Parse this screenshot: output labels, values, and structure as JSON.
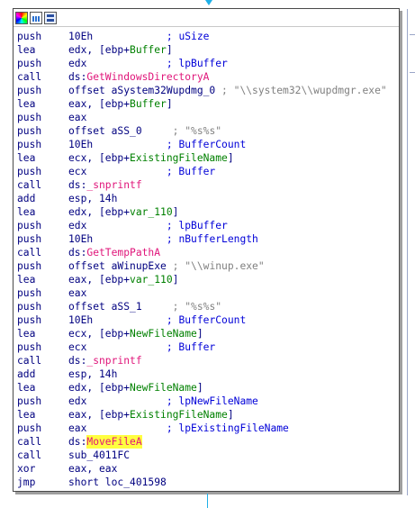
{
  "colors": {
    "instruction": "#000080",
    "comment": "#0000d8",
    "string_comment": "#808080",
    "api_reference": "#e0157a",
    "local_variable": "#008000",
    "highlight": "#ffff40",
    "edge": "#1fb0e8"
  },
  "titlebar_icons": [
    "color-palette-icon",
    "bar-chart-icon",
    "graph-overview-icon"
  ],
  "lines": [
    {
      "mn": "push",
      "p": [
        {
          "t": "10Eh",
          "c": "op"
        }
      ],
      "g": "            ",
      "cm": [
        {
          "t": "; uSize",
          "c": "cm"
        }
      ]
    },
    {
      "mn": "lea",
      "p": [
        {
          "t": "edx, [ebp+",
          "c": "op"
        },
        {
          "t": "Buffer",
          "c": "loc"
        },
        {
          "t": "]",
          "c": "op"
        }
      ],
      "g": "",
      "cm": []
    },
    {
      "mn": "push",
      "p": [
        {
          "t": "edx",
          "c": "op"
        }
      ],
      "g": "             ",
      "cm": [
        {
          "t": "; lpBuffer",
          "c": "cm"
        }
      ]
    },
    {
      "mn": "call",
      "p": [
        {
          "t": "ds:",
          "c": "op"
        },
        {
          "t": "GetWindowsDirectoryA",
          "c": "ref"
        }
      ],
      "g": "",
      "cm": []
    },
    {
      "mn": "push",
      "p": [
        {
          "t": "offset aSystem32Wupdmg_0",
          "c": "op"
        }
      ],
      "g": " ",
      "cm": [
        {
          "t": "; \"\\\\system32\\\\wupdmgr.exe\"",
          "c": "str"
        }
      ]
    },
    {
      "mn": "lea",
      "p": [
        {
          "t": "eax, [ebp+",
          "c": "op"
        },
        {
          "t": "Buffer",
          "c": "loc"
        },
        {
          "t": "]",
          "c": "op"
        }
      ],
      "g": "",
      "cm": []
    },
    {
      "mn": "push",
      "p": [
        {
          "t": "eax",
          "c": "op"
        }
      ],
      "g": "",
      "cm": []
    },
    {
      "mn": "push",
      "p": [
        {
          "t": "offset aSS_0",
          "c": "op"
        }
      ],
      "g": "     ",
      "cm": [
        {
          "t": "; \"%s%s\"",
          "c": "str"
        }
      ]
    },
    {
      "mn": "push",
      "p": [
        {
          "t": "10Eh",
          "c": "op"
        }
      ],
      "g": "            ",
      "cm": [
        {
          "t": "; BufferCount",
          "c": "cm"
        }
      ]
    },
    {
      "mn": "lea",
      "p": [
        {
          "t": "ecx, [ebp+",
          "c": "op"
        },
        {
          "t": "ExistingFileName",
          "c": "loc"
        },
        {
          "t": "]",
          "c": "op"
        }
      ],
      "g": "",
      "cm": []
    },
    {
      "mn": "push",
      "p": [
        {
          "t": "ecx",
          "c": "op"
        }
      ],
      "g": "             ",
      "cm": [
        {
          "t": "; Buffer",
          "c": "cm"
        }
      ]
    },
    {
      "mn": "call",
      "p": [
        {
          "t": "ds:",
          "c": "op"
        },
        {
          "t": "_snprintf",
          "c": "ref"
        }
      ],
      "g": "",
      "cm": []
    },
    {
      "mn": "add",
      "p": [
        {
          "t": "esp, 14h",
          "c": "op"
        }
      ],
      "g": "",
      "cm": []
    },
    {
      "mn": "lea",
      "p": [
        {
          "t": "edx, [ebp+",
          "c": "op"
        },
        {
          "t": "var_110",
          "c": "loc"
        },
        {
          "t": "]",
          "c": "op"
        }
      ],
      "g": "",
      "cm": []
    },
    {
      "mn": "push",
      "p": [
        {
          "t": "edx",
          "c": "op"
        }
      ],
      "g": "             ",
      "cm": [
        {
          "t": "; lpBuffer",
          "c": "cm"
        }
      ]
    },
    {
      "mn": "push",
      "p": [
        {
          "t": "10Eh",
          "c": "op"
        }
      ],
      "g": "            ",
      "cm": [
        {
          "t": "; nBufferLength",
          "c": "cm"
        }
      ]
    },
    {
      "mn": "call",
      "p": [
        {
          "t": "ds:",
          "c": "op"
        },
        {
          "t": "GetTempPathA",
          "c": "ref"
        }
      ],
      "g": "",
      "cm": []
    },
    {
      "mn": "push",
      "p": [
        {
          "t": "offset aWinupExe",
          "c": "op"
        }
      ],
      "g": " ",
      "cm": [
        {
          "t": "; \"\\\\winup.exe\"",
          "c": "str"
        }
      ]
    },
    {
      "mn": "lea",
      "p": [
        {
          "t": "eax, [ebp+",
          "c": "op"
        },
        {
          "t": "var_110",
          "c": "loc"
        },
        {
          "t": "]",
          "c": "op"
        }
      ],
      "g": "",
      "cm": []
    },
    {
      "mn": "push",
      "p": [
        {
          "t": "eax",
          "c": "op"
        }
      ],
      "g": "",
      "cm": []
    },
    {
      "mn": "push",
      "p": [
        {
          "t": "offset aSS_1",
          "c": "op"
        }
      ],
      "g": "     ",
      "cm": [
        {
          "t": "; \"%s%s\"",
          "c": "str"
        }
      ]
    },
    {
      "mn": "push",
      "p": [
        {
          "t": "10Eh",
          "c": "op"
        }
      ],
      "g": "            ",
      "cm": [
        {
          "t": "; BufferCount",
          "c": "cm"
        }
      ]
    },
    {
      "mn": "lea",
      "p": [
        {
          "t": "ecx, [ebp+",
          "c": "op"
        },
        {
          "t": "NewFileName",
          "c": "loc"
        },
        {
          "t": "]",
          "c": "op"
        }
      ],
      "g": "",
      "cm": []
    },
    {
      "mn": "push",
      "p": [
        {
          "t": "ecx",
          "c": "op"
        }
      ],
      "g": "             ",
      "cm": [
        {
          "t": "; Buffer",
          "c": "cm"
        }
      ]
    },
    {
      "mn": "call",
      "p": [
        {
          "t": "ds:",
          "c": "op"
        },
        {
          "t": "_snprintf",
          "c": "ref"
        }
      ],
      "g": "",
      "cm": []
    },
    {
      "mn": "add",
      "p": [
        {
          "t": "esp, 14h",
          "c": "op"
        }
      ],
      "g": "",
      "cm": []
    },
    {
      "mn": "lea",
      "p": [
        {
          "t": "edx, [ebp+",
          "c": "op"
        },
        {
          "t": "NewFileName",
          "c": "loc"
        },
        {
          "t": "]",
          "c": "op"
        }
      ],
      "g": "",
      "cm": []
    },
    {
      "mn": "push",
      "p": [
        {
          "t": "edx",
          "c": "op"
        }
      ],
      "g": "             ",
      "cm": [
        {
          "t": "; lpNewFileName",
          "c": "cm"
        }
      ]
    },
    {
      "mn": "lea",
      "p": [
        {
          "t": "eax, [ebp+",
          "c": "op"
        },
        {
          "t": "ExistingFileName",
          "c": "loc"
        },
        {
          "t": "]",
          "c": "op"
        }
      ],
      "g": "",
      "cm": []
    },
    {
      "mn": "push",
      "p": [
        {
          "t": "eax",
          "c": "op"
        }
      ],
      "g": "             ",
      "cm": [
        {
          "t": "; lpExistingFileName",
          "c": "cm"
        }
      ]
    },
    {
      "mn": "call",
      "p": [
        {
          "t": "ds:",
          "c": "op"
        },
        {
          "t": "MoveFileA",
          "c": "hl"
        }
      ],
      "g": "",
      "cm": []
    },
    {
      "mn": "call",
      "p": [
        {
          "t": "sub_4011FC",
          "c": "op"
        }
      ],
      "g": "",
      "cm": []
    },
    {
      "mn": "xor",
      "p": [
        {
          "t": "eax, eax",
          "c": "op"
        }
      ],
      "g": "",
      "cm": []
    },
    {
      "mn": "jmp",
      "p": [
        {
          "t": "short loc_401598",
          "c": "op"
        }
      ],
      "g": "",
      "cm": []
    }
  ]
}
